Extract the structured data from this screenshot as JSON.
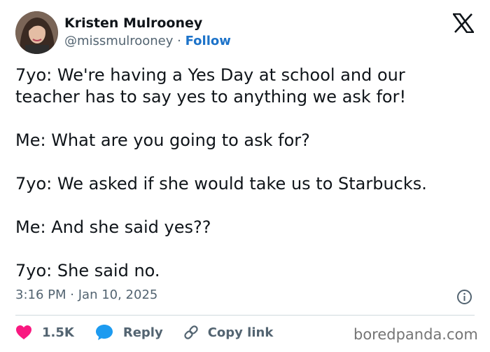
{
  "author": {
    "name": "Kristen Mulrooney",
    "handle": "@missmulrooney",
    "separator": "·",
    "follow_label": "Follow"
  },
  "logo": {
    "icon": "x-logo-icon"
  },
  "tweet": {
    "paragraphs": [
      "7yo: We're having a Yes Day at school and our",
      "teacher has to say yes to anything we ask for!",
      "Me: What are you going to ask for?",
      "7yo: We asked if she would take us to Starbucks.",
      "Me: And she said yes??",
      "7yo: She said no."
    ]
  },
  "meta": {
    "time": "3:16 PM",
    "separator": "·",
    "date": "Jan 10, 2025",
    "info_icon": "info-icon"
  },
  "actions": {
    "like_count": "1.5K",
    "reply_label": "Reply",
    "copy_link_label": "Copy link"
  },
  "colors": {
    "like": "#f91880",
    "reply": "#1d9bf0",
    "follow": "#1d73c9",
    "muted": "#536471",
    "text": "#0f1419"
  },
  "watermark": "boredpanda.com"
}
